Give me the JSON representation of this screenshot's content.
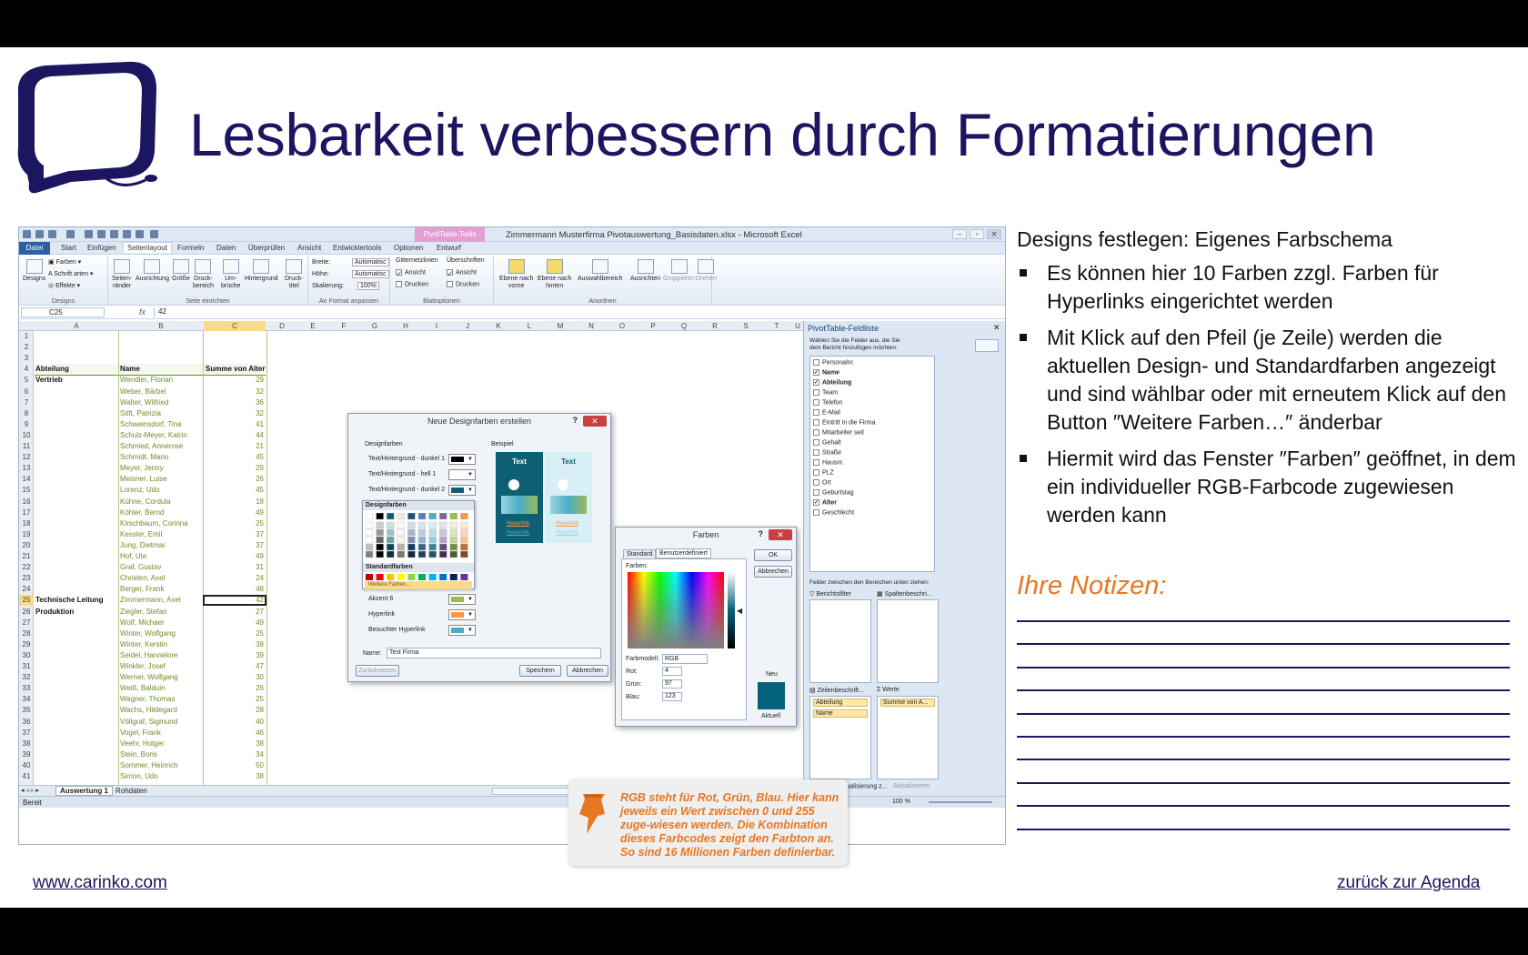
{
  "slide_title": "Lesbarkeit verbessern durch Formatierungen",
  "excel": {
    "window_title": "Zimmermann Musterfirma Pivotauswertung_Basisdaten.xlsx  -  Microsoft Excel",
    "contextual_tab": "PivotTable-Tools",
    "tabs": [
      "Datei",
      "Start",
      "Einfügen",
      "Seitenlayout",
      "Formeln",
      "Daten",
      "Überprüfen",
      "Ansicht",
      "Entwicklertools",
      "Optionen",
      "Entwurf"
    ],
    "ribbon": {
      "designs": {
        "designs": "Designs",
        "farben": "Farben",
        "schriftarten": "Schrift arten",
        "effekte": "Effekte",
        "group": "Designs"
      },
      "seite": {
        "raender": "Seiten-\nränder",
        "ausrichtung": "Ausrichtung",
        "groesse": "Größe",
        "druckbereich": "Druck-\nbereich",
        "umbrueche": "Um-\nbrüche",
        "hintergrund": "Hintergrund",
        "drucktitel": "Druck-\ntitel",
        "group": "Seite einrichten"
      },
      "anpassen": {
        "breite": "Breite:",
        "hoehe": "Höhe:",
        "skalierung": "Skalierung:",
        "breite_val": "Automatisc",
        "hoehe_val": "Automatisc",
        "skal_val": "100%",
        "group": "An Format anpassen"
      },
      "blatt": {
        "gitter": "Gitternetzlinien",
        "ueber": "Überschriften",
        "ansicht": "Ansicht",
        "drucken": "Drucken",
        "group": "Blattoptionen"
      },
      "anordnen": {
        "vorne": "Ebene nach\nvorne",
        "hinten": "Ebene nach\nhinten",
        "auswahl": "Auswahlbereich",
        "ausrichten": "Ausrichten",
        "gruppieren": "Gruppieren",
        "drehen": "Drehen",
        "group": "Anordnen"
      }
    },
    "name_box": "C25",
    "fx": "fx",
    "formula_value": "42",
    "columns": [
      "A",
      "B",
      "C",
      "D",
      "E",
      "F",
      "G",
      "H",
      "I",
      "J",
      "K",
      "L",
      "M",
      "N",
      "O",
      "P",
      "Q",
      "R",
      "S",
      "T",
      "U"
    ],
    "header_row": {
      "a": "Abteilung",
      "b": "Name",
      "c": "Summe von Alter"
    },
    "rows": [
      {
        "n": "1",
        "a": "",
        "b": "",
        "c": ""
      },
      {
        "n": "2",
        "a": "",
        "b": "",
        "c": ""
      },
      {
        "n": "3",
        "a": "",
        "b": "",
        "c": ""
      },
      {
        "n": "4",
        "a": "",
        "b": "",
        "c": ""
      },
      {
        "n": "5",
        "a": "Vertrieb",
        "b": "Wendler, Florian",
        "c": "29"
      },
      {
        "n": "6",
        "a": "",
        "b": "Weber, Bärbel",
        "c": "32"
      },
      {
        "n": "7",
        "a": "",
        "b": "Walter, Wilfried",
        "c": "36"
      },
      {
        "n": "8",
        "a": "",
        "b": "Stift, Patrizia",
        "c": "32"
      },
      {
        "n": "9",
        "a": "",
        "b": "Schweinsdorf, Tina",
        "c": "41"
      },
      {
        "n": "10",
        "a": "",
        "b": "Schulz-Meyer, Katrin",
        "c": "44"
      },
      {
        "n": "11",
        "a": "",
        "b": "Schmied, Annerose",
        "c": "21"
      },
      {
        "n": "12",
        "a": "",
        "b": "Schmidt, Mario",
        "c": "45"
      },
      {
        "n": "13",
        "a": "",
        "b": "Meyer, Jenny",
        "c": "29"
      },
      {
        "n": "14",
        "a": "",
        "b": "Meisner, Luise",
        "c": "26"
      },
      {
        "n": "15",
        "a": "",
        "b": "Lorenz, Udo",
        "c": "45"
      },
      {
        "n": "16",
        "a": "",
        "b": "Kühne, Cordula",
        "c": "18"
      },
      {
        "n": "17",
        "a": "",
        "b": "Köhler, Bernd",
        "c": "49"
      },
      {
        "n": "18",
        "a": "",
        "b": "Kirschbaum, Corinna",
        "c": "25"
      },
      {
        "n": "19",
        "a": "",
        "b": "Kessler, Emil",
        "c": "37"
      },
      {
        "n": "20",
        "a": "",
        "b": "Jung, Dietmar",
        "c": "37"
      },
      {
        "n": "21",
        "a": "",
        "b": "Hof, Ute",
        "c": "49"
      },
      {
        "n": "22",
        "a": "",
        "b": "Graf, Gustav",
        "c": "31"
      },
      {
        "n": "23",
        "a": "",
        "b": "Christen, Axel",
        "c": "24"
      },
      {
        "n": "24",
        "a": "",
        "b": "Berger, Frank",
        "c": "48"
      },
      {
        "n": "25",
        "a": "Technische Leitung",
        "b": "Zimmermann, Axel",
        "c": "42"
      },
      {
        "n": "26",
        "a": "Produktion",
        "b": "Ziegler, Stefan",
        "c": "27"
      },
      {
        "n": "27",
        "a": "",
        "b": "Wolf, Michael",
        "c": "49"
      },
      {
        "n": "28",
        "a": "",
        "b": "Winter, Wolfgang",
        "c": "25"
      },
      {
        "n": "29",
        "a": "",
        "b": "Winter, Kerstin",
        "c": "38"
      },
      {
        "n": "30",
        "a": "",
        "b": "Seidel, Hannelore",
        "c": "39"
      },
      {
        "n": "31",
        "a": "",
        "b": "Winkler, Josef",
        "c": "47"
      },
      {
        "n": "32",
        "a": "",
        "b": "Werner, Wolfgang",
        "c": "30"
      },
      {
        "n": "33",
        "a": "",
        "b": "Weiß, Balduin",
        "c": "26"
      },
      {
        "n": "34",
        "a": "",
        "b": "Wagner, Thomas",
        "c": "25"
      },
      {
        "n": "35",
        "a": "",
        "b": "Wachs, Hildegard",
        "c": "28"
      },
      {
        "n": "36",
        "a": "",
        "b": "Völlgraf, Sigmund",
        "c": "40"
      },
      {
        "n": "37",
        "a": "",
        "b": "Vogel, Frank",
        "c": "46"
      },
      {
        "n": "38",
        "a": "",
        "b": "Veehr, Holger",
        "c": "38"
      },
      {
        "n": "39",
        "a": "",
        "b": "Stein, Boris",
        "c": "34"
      },
      {
        "n": "40",
        "a": "",
        "b": "Sommer, Heinrich",
        "c": "50"
      },
      {
        "n": "41",
        "a": "",
        "b": "Simon, Udo",
        "c": "38"
      }
    ],
    "sheet_tabs": [
      "Auswertung 1",
      "Rohdaten"
    ],
    "status_ready": "Bereit",
    "zoom": "100 %",
    "pivot_pane": {
      "title": "PivotTable-Feldliste",
      "instruction": "Wählen Sie die Felder aus, die Sie dem Bericht hinzufügen möchten:",
      "fields": [
        {
          "label": "Personalnr.",
          "checked": false
        },
        {
          "label": "Name",
          "checked": true
        },
        {
          "label": "Abteilung",
          "checked": true
        },
        {
          "label": "Team",
          "checked": false
        },
        {
          "label": "Telefon",
          "checked": false
        },
        {
          "label": "E-Mail",
          "checked": false
        },
        {
          "label": "Eintritt in die Firma",
          "checked": false
        },
        {
          "label": "Mitarbeiter seit",
          "checked": false
        },
        {
          "label": "Gehalt",
          "checked": false
        },
        {
          "label": "Straße",
          "checked": false
        },
        {
          "label": "Hausnr.",
          "checked": false
        },
        {
          "label": "PLZ",
          "checked": false
        },
        {
          "label": "Ort",
          "checked": false
        },
        {
          "label": "Geburtstag",
          "checked": false
        },
        {
          "label": "Alter",
          "checked": true
        },
        {
          "label": "Geschlecht",
          "checked": false
        }
      ],
      "areas_label": "Felder zwischen den Bereichen unten ziehen:",
      "berichtsfilter": "Berichtsfilter",
      "spalten": "Spaltenbeschri...",
      "zeilen": "Zeilenbeschrift...",
      "werte": "Werte",
      "zeilen_items": [
        "Abteilung",
        "Name"
      ],
      "werte_items": [
        "Summe von A..."
      ],
      "defer": "Layoutaktualisierung z...",
      "update": "Aktualisieren"
    },
    "dialog_design": {
      "title": "Neue Designfarben erstellen",
      "group_colors": "Designfarben",
      "group_example": "Beispiel",
      "rows": [
        {
          "label": "Text/Hintergrund - dunkel 1",
          "color": "#000000"
        },
        {
          "label": "Text/Hintergrund - hell 1",
          "color": "#ffffff"
        },
        {
          "label": "Text/Hintergrund - dunkel 2",
          "color": "#0f5f74"
        }
      ],
      "rows_bottom": [
        {
          "label": "Akzent 6",
          "color": "#9bbb59"
        },
        {
          "label": "Hyperlink",
          "color": "#f79646"
        },
        {
          "label": "Besuchter Hyperlink",
          "color": "#4bacc6"
        }
      ],
      "popup_design": "Designfarben",
      "popup_standard": "Standardfarben",
      "popup_more": "Weitere Farben...",
      "example_text": "Text",
      "example_link": "Hyperlink",
      "name_label": "Name:",
      "name_value": "Test Firma",
      "reset": "Zurücksetzen",
      "save": "Speichern",
      "cancel": "Abbrechen"
    },
    "dialog_farben": {
      "title": "Farben",
      "tab_standard": "Standard",
      "tab_custom": "Benutzerdefiniert",
      "ok": "OK",
      "cancel": "Abbrechen",
      "colors_label": "Farben:",
      "model_label": "Farbmodell:",
      "model_value": "RGB",
      "rot_label": "Rot:",
      "rot": "4",
      "gruen_label": "Grün:",
      "gruen": "97",
      "blau_label": "Blau:",
      "blau": "123",
      "neu": "Neu",
      "aktuell": "Aktuell",
      "new_color": "#04617b"
    }
  },
  "tip_text": "RGB steht für Rot, Grün, Blau. Hier kann jeweils ein Wert zwischen 0 und 255 zuge-wiesen werden. Die Kombination dieses Farbcodes zeigt den Farbton an. So sind 16 Millionen Farben definierbar.",
  "right": {
    "subtitle": "Designs festlegen: Eigenes Farbschema",
    "bullets": [
      "Es können hier 10 Farben zzgl. Farben für Hyperlinks eingerichtet werden",
      "Mit Klick auf den Pfeil (je Zeile) werden die aktuellen Design- und Standardfarben angezeigt und sind wählbar oder mit erneutem Klick auf den Button ″Weitere Farben…″ änderbar",
      "Hiermit wird das Fenster ″Farben″ geöffnet, in dem ein individueller RGB-Farbcode zugewiesen werden kann"
    ],
    "notes_label": "Ihre Notizen:"
  },
  "footer": {
    "website": "www.carinko.com",
    "back": "zurück  zur  Agenda"
  },
  "colors": {
    "brand": "#1c1660",
    "accent": "#e87722",
    "data_green": "#6e8c28"
  }
}
